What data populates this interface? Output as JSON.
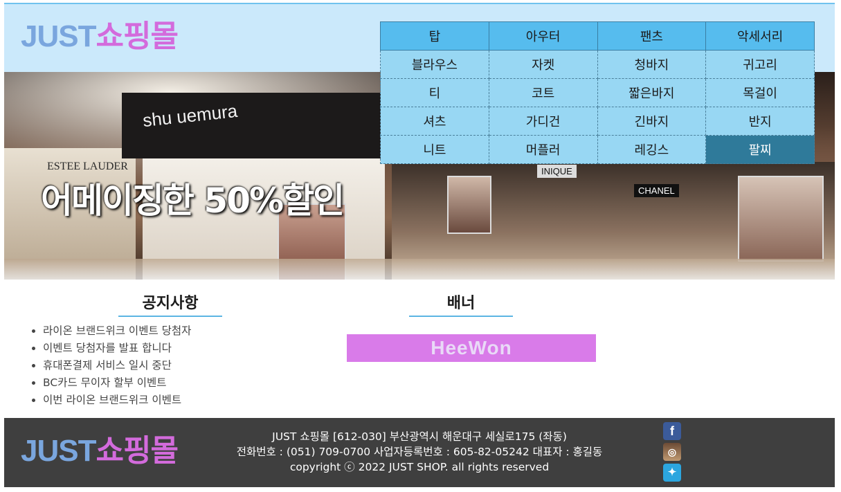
{
  "logo": {
    "part1": "JUST",
    "part2": "쇼핑몰"
  },
  "menu": {
    "rows": [
      [
        "탑",
        "아우터",
        "팬츠",
        "악세서리"
      ],
      [
        "블라우스",
        "자켓",
        "청바지",
        "귀고리"
      ],
      [
        "티",
        "코트",
        "짧은바지",
        "목걸이"
      ],
      [
        "셔츠",
        "가디건",
        "긴바지",
        "반지"
      ],
      [
        "니트",
        "머플러",
        "레깅스",
        "팔찌"
      ]
    ],
    "active_item": "팔찌"
  },
  "hero": {
    "headline": "어메이징한 50%할인",
    "store_signs": [
      "shu uemura",
      "ESTEE LAUDER",
      "CHANEL",
      "INIQUE"
    ]
  },
  "notice": {
    "title": "공지사항",
    "items": [
      "라이온 브랜드위크 이벤트 당첨자",
      "이벤트 당첨자를 발표 합니다",
      "휴대폰결제 서비스 일시 중단",
      "BC카드 무이자 할부 이벤트",
      "이번 라이온 브랜드위크 이벤트"
    ]
  },
  "banner": {
    "title": "배너",
    "text": "HeeWon",
    "color": "#d97be9"
  },
  "footer": {
    "line1": "JUST 쇼핑몰 [612-030] 부산광역시 해운대구 세실로175 (좌동)",
    "line2": "전화번호 : (051) 709-0700 사업자등록번호 : 605-82-05242 대표자 : 홍길동",
    "line3": "copyright ⓒ 2022 JUST SHOP. all rights reserved"
  },
  "social": [
    "facebook-icon",
    "instagram-icon",
    "twitter-icon"
  ],
  "colors": {
    "header_bg": "#cbe9fb",
    "menu_cell": "#98d7f3",
    "menu_head": "#56bcee",
    "menu_active": "#2f7a9a",
    "footer_bg": "#3f3f3f"
  }
}
